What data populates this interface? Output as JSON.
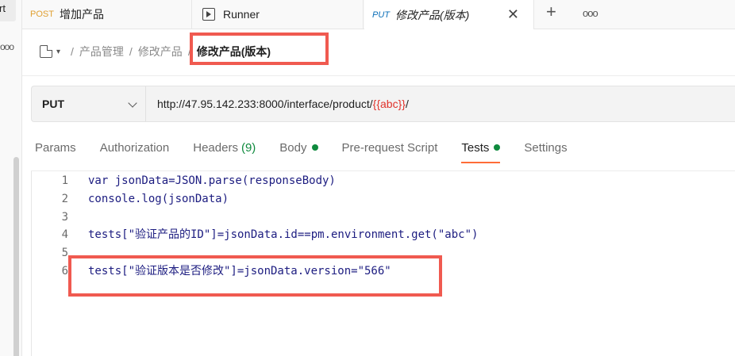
{
  "sidebar": {
    "tab_fragment": "rt",
    "more_icon": "ooo"
  },
  "tabs": {
    "items": [
      {
        "method": "POST",
        "label": "增加产品"
      },
      {
        "label": "Runner"
      },
      {
        "method": "PUT",
        "label": "修改产品(版本)",
        "close": "✕"
      }
    ],
    "add_icon": "+",
    "more_icon": "ooo"
  },
  "breadcrumb": {
    "items": [
      "产品管理",
      "修改产品"
    ],
    "separator": "/",
    "current": "修改产品(版本)",
    "caret": "▾"
  },
  "request": {
    "method": "PUT",
    "url_prefix": "http://47.95.142.233:8000/interface/product/",
    "url_var": "{{abc}}",
    "url_suffix": "/"
  },
  "request_tabs": [
    {
      "label": "Params"
    },
    {
      "label": "Authorization"
    },
    {
      "label": "Headers",
      "count": "(9)"
    },
    {
      "label": "Body"
    },
    {
      "label": "Pre-request Script"
    },
    {
      "label": "Tests"
    },
    {
      "label": "Settings"
    }
  ],
  "editor": {
    "lines": [
      {
        "num": "1",
        "code": "var jsonData=JSON.parse(responseBody)"
      },
      {
        "num": "2",
        "code": "console.log(jsonData)"
      },
      {
        "num": "3",
        "code": ""
      },
      {
        "num": "4",
        "code": "tests[\"验证产品的ID\"]=jsonData.id==pm.environment.get(\"abc\")"
      },
      {
        "num": "5",
        "code": ""
      },
      {
        "num": "6",
        "code": "tests[\"验证版本是否修改\"]=jsonData.version=\"566\""
      }
    ]
  },
  "colors": {
    "accent": "#ff6c37",
    "status_green": "#0f8a3e",
    "highlight_red": "#f05a50",
    "post": "#e0a032",
    "put": "#0b6fb8"
  }
}
